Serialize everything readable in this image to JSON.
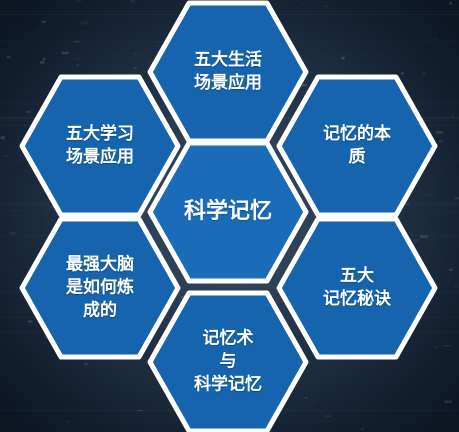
{
  "diagram": {
    "center": {
      "id": "center",
      "label": "科学记忆"
    },
    "topics": [
      {
        "id": "top",
        "label": "五大生活\n场景应用"
      },
      {
        "id": "upper-left",
        "label": "五大学习\n场景应用"
      },
      {
        "id": "upper-right",
        "label": "记忆的本\n质"
      },
      {
        "id": "lower-left",
        "label": "最强大脑\n是如何炼\n成的"
      },
      {
        "id": "lower-right",
        "label": "五大\n记忆秘诀"
      },
      {
        "id": "bottom",
        "label": "记忆术\n与\n科学记忆"
      }
    ]
  },
  "colors": {
    "hex_fill": "#1564ad",
    "hex_border": "#ffffff",
    "text": "#ffffff",
    "background": "#1a2838"
  }
}
